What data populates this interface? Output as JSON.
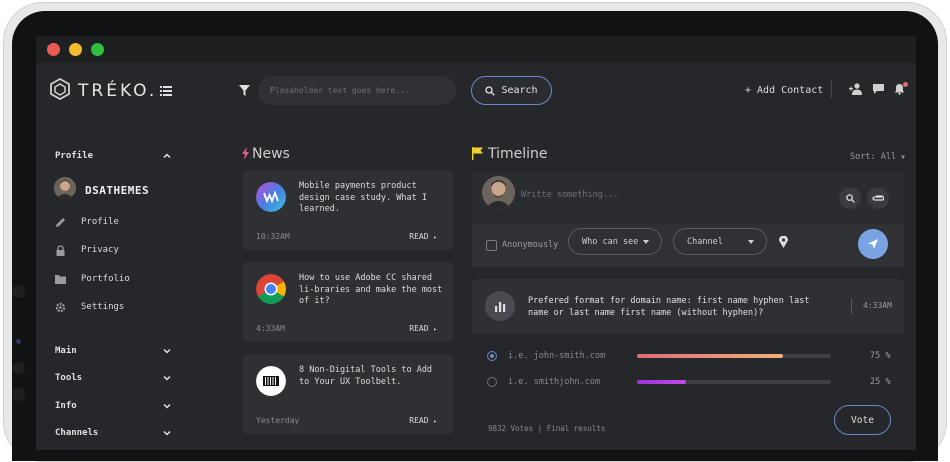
{
  "app": {
    "brand": "TRÉKO."
  },
  "header": {
    "search_placeholder": "Plasaholder text goes here...",
    "search_button": "Search",
    "add_contact": "+ Add Contact"
  },
  "sidebar": {
    "profile_section": "Profile",
    "user_name": "DSATHEMES",
    "items": [
      {
        "label": "Profile",
        "icon": "pencil-icon"
      },
      {
        "label": "Privacy",
        "icon": "lock-icon"
      },
      {
        "label": "Portfolio",
        "icon": "folder-icon"
      },
      {
        "label": "Settings",
        "icon": "gear-icon"
      }
    ],
    "sections": [
      {
        "label": "Main"
      },
      {
        "label": "Tools"
      },
      {
        "label": "Info"
      },
      {
        "label": "Channels"
      }
    ]
  },
  "news": {
    "title": "News",
    "items": [
      {
        "text": "Mobile payments product design case study. What I learned.",
        "time": "10:32AM",
        "read": "READ",
        "icon": "gradient-logo-icon"
      },
      {
        "text": "How to use Adobe CC shared li-braries and make the most of it?",
        "time": "4:33AM",
        "read": "READ",
        "icon": "chrome-icon"
      },
      {
        "text": "8 Non-Digital Tools to Add to Your UX Toolbelt.",
        "time": "Yesterday",
        "read": "READ",
        "icon": "barcode-icon"
      }
    ]
  },
  "timeline": {
    "title": "Timeline",
    "sort": "Sort: All",
    "composer_placeholder": "Writte something...",
    "anonymously": "Anonymously",
    "who_can_see": "Who can see",
    "channel": "Channel",
    "poll": {
      "question": "Prefered format for domain name: first name hyphen last name or last name first name (without hyphen)?",
      "time": "4:33AM",
      "options": [
        {
          "label": "i.e. john-smith.com",
          "percent_text": "75 %",
          "percent": 75,
          "selected": true,
          "color_start": "#e06a7a",
          "color_end": "#f0b27a"
        },
        {
          "label": "i.e. smithjohn.com",
          "percent_text": "25 %",
          "percent": 25,
          "selected": false,
          "color_start": "#9b34d8",
          "color_end": "#c24bea"
        }
      ],
      "summary": "9832 Votes | Final results",
      "vote_button": "Vote"
    }
  },
  "colors": {
    "background": "#26272a",
    "card": "#2f3033",
    "accent_blue": "#6a87c8",
    "send_blue": "#7aa3e6"
  }
}
